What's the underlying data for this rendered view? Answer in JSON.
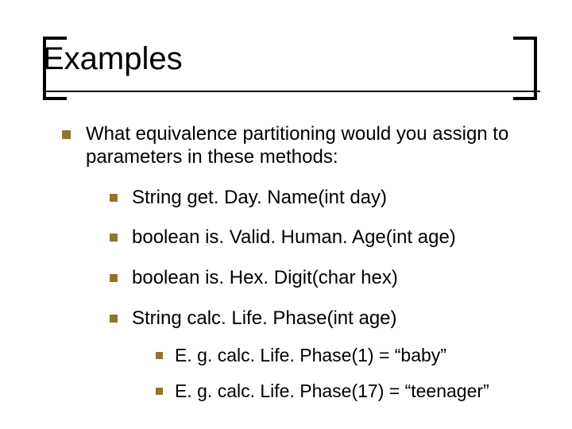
{
  "title": "Examples",
  "intro": "What equivalence partitioning would you assign to parameters in these methods:",
  "methods": {
    "m1": "String get. Day. Name(int day)",
    "m2": "boolean is. Valid. Human. Age(int age)",
    "m3": "boolean is. Hex. Digit(char hex)",
    "m4": "String calc. Life. Phase(int age)"
  },
  "examples": {
    "e1": "E. g. calc. Life. Phase(1) = “baby”",
    "e2": "E. g. calc. Life. Phase(17) = “teenager”"
  }
}
